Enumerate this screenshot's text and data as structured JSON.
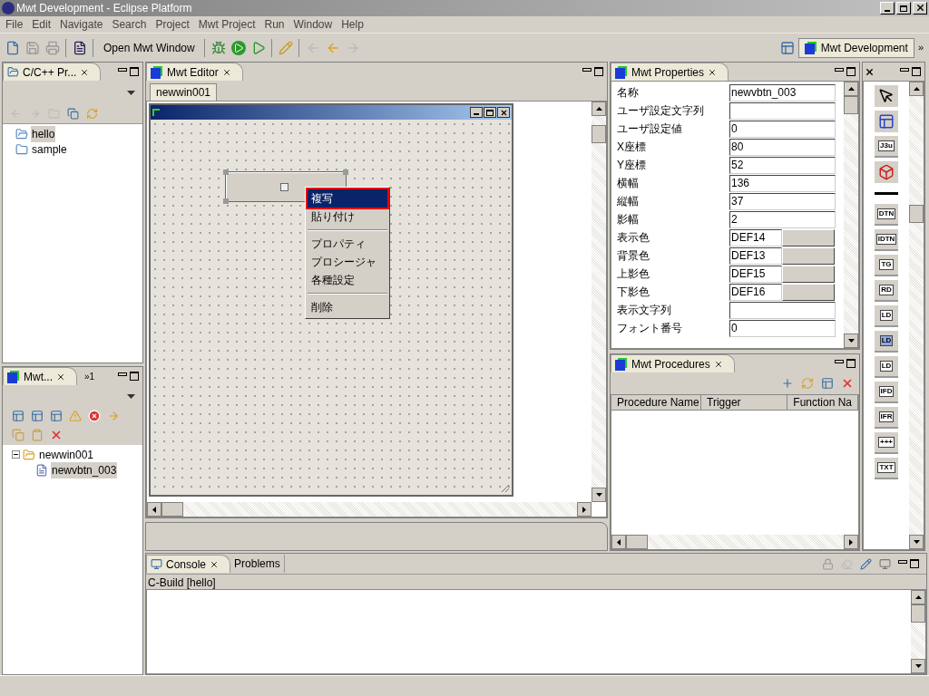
{
  "window": {
    "title": "Mwt Development - Eclipse Platform"
  },
  "menu": [
    "File",
    "Edit",
    "Navigate",
    "Search",
    "Project",
    "Mwt Project",
    "Run",
    "Window",
    "Help"
  ],
  "toolbar": {
    "open_button": "Open Mwt Window"
  },
  "perspective": {
    "label": "Mwt Development",
    "more": "»"
  },
  "project_explorer": {
    "title": "C/C++ Pr...",
    "items": [
      {
        "label": "hello",
        "selected": true
      },
      {
        "label": "sample",
        "selected": false
      }
    ]
  },
  "outline": {
    "title": "Mwt...",
    "overflow": "»1",
    "tree": [
      {
        "label": "newwin001",
        "expanded": true,
        "selected": false,
        "children": [
          {
            "label": "newvbtn_003",
            "selected": true
          }
        ]
      }
    ]
  },
  "editor": {
    "title": "Mwt Editor",
    "tab": "newwin001",
    "context_menu": [
      {
        "kind": "item",
        "label": "複写",
        "selected": true
      },
      {
        "kind": "item",
        "label": "貼り付け",
        "selected": false
      },
      {
        "kind": "separator"
      },
      {
        "kind": "item",
        "label": "プロパティ",
        "selected": false
      },
      {
        "kind": "item",
        "label": "プロシージャ",
        "selected": false
      },
      {
        "kind": "item",
        "label": "各種設定",
        "selected": false
      },
      {
        "kind": "separator"
      },
      {
        "kind": "item",
        "label": "削除",
        "selected": false
      }
    ]
  },
  "properties": {
    "title": "Mwt Properties",
    "rows": [
      {
        "name": "名称",
        "value": "newvbtn_003",
        "kind": "text"
      },
      {
        "name": "ユーザ設定文字列",
        "value": "",
        "kind": "text"
      },
      {
        "name": "ユーザ設定値",
        "value": "0",
        "kind": "text"
      },
      {
        "name": "X座標",
        "value": "80",
        "kind": "text"
      },
      {
        "name": "Y座標",
        "value": "52",
        "kind": "text"
      },
      {
        "name": "横幅",
        "value": "136",
        "kind": "text"
      },
      {
        "name": "縦幅",
        "value": "37",
        "kind": "text"
      },
      {
        "name": "影幅",
        "value": "2",
        "kind": "text"
      },
      {
        "name": "表示色",
        "value": "DEF14",
        "kind": "color"
      },
      {
        "name": "背景色",
        "value": "DEF13",
        "kind": "color"
      },
      {
        "name": "上影色",
        "value": "DEF15",
        "kind": "color"
      },
      {
        "name": "下影色",
        "value": "DEF16",
        "kind": "color"
      },
      {
        "name": "表示文字列",
        "value": "",
        "kind": "text"
      },
      {
        "name": "フォント番号",
        "value": "0",
        "kind": "text"
      }
    ]
  },
  "procedures": {
    "title": "Mwt Procedures",
    "columns": [
      "Procedure Name",
      "Trigger",
      "Function Na"
    ]
  },
  "palette": {
    "items": [
      {
        "label": "J3u",
        "selected": false
      },
      {
        "label": "DTN",
        "selected": false
      },
      {
        "label": "IDTN",
        "selected": false
      },
      {
        "label": "TG",
        "selected": false
      },
      {
        "label": "RD",
        "selected": false
      },
      {
        "label": "LD",
        "selected": false
      },
      {
        "label": "LD",
        "selected": true
      },
      {
        "label": "LD",
        "selected": false
      },
      {
        "label": "IFD",
        "selected": false
      },
      {
        "label": "IFR",
        "selected": false
      },
      {
        "label": "+++",
        "selected": false
      },
      {
        "label": "TXT",
        "selected": false
      }
    ]
  },
  "console": {
    "tabs": [
      {
        "label": "Console",
        "selected": true
      },
      {
        "label": "Problems",
        "selected": false
      }
    ],
    "text": "C-Build [hello]"
  }
}
